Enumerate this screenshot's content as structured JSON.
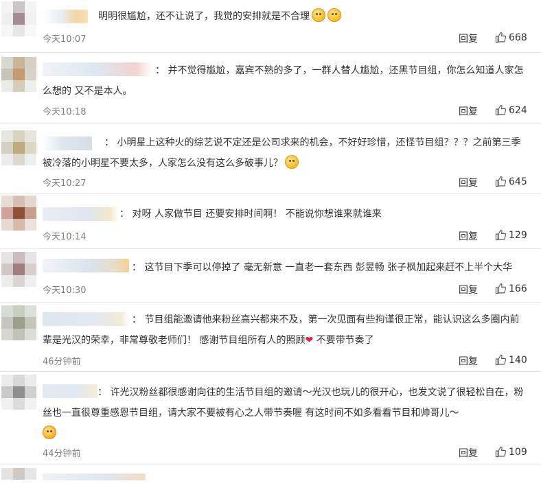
{
  "comments": [
    {
      "text": "明明很尴尬，还不让说了，我觉的安排就是不合理",
      "emojis": [
        "shush-face-emoji",
        "shush-face-emoji"
      ],
      "time": "今天10:07",
      "reply_label": "回复",
      "likes": "668"
    },
    {
      "text": "：  并不觉得尴尬，嘉宾不熟的多了，一群人替人尴尬，还黑节目组，你怎么知道人家怎么想的 又不是本人。",
      "time": "今天10:18",
      "reply_label": "回复",
      "likes": "624"
    },
    {
      "text": "：  小明星上这种火的综艺说不定还是公司求来的机会，不好好珍惜，还怪节目组？？？之前第三季被冷落的小明星不要太多，人家怎么没有这么多破事儿？",
      "emojis": [
        "smile-face-emoji"
      ],
      "time": "今天10:27",
      "reply_label": "回复",
      "likes": "645"
    },
    {
      "text": "：  对呀 人家做节目 还要安排时间啊！ 不能说你想谁来就谁来",
      "time": "今天10:14",
      "reply_label": "回复",
      "likes": "129"
    },
    {
      "text": "：  这节目下季可以停掉了 毫无新意 一直老一套东西 彭昱畅 张子枫加起来赶不上半个大华",
      "time": "今天10:30",
      "reply_label": "回复",
      "likes": "166"
    },
    {
      "text": "：  节目组能邀请他来粉丝高兴都来不及，第一次见面有些拘谨很正常，能认识这么多圈内前辈是光汉的荣幸，非常尊敬老师们！ 感谢节目组所有人的照顾",
      "text_tail": " 不要带节奏了",
      "time": "46分钟前",
      "reply_label": "回复",
      "likes": "140"
    },
    {
      "text": "：  许光汉粉丝都很感谢向往的生活节目组的邀请～光汉也玩儿的很开心，也发文说了很轻松自在，粉丝也一直很尊重感恩节目组，请大家不要被有心之人带节奏喔 有这时间不如多看看节目和帅哥儿～",
      "emojis": [
        "blush-face-emoji"
      ],
      "time": "44分钟前",
      "reply_label": "回复",
      "likes": "109"
    }
  ],
  "colors": {
    "text": "#333333",
    "time": "#808080",
    "divider": "#e8e8e8",
    "heart": "#e0213d"
  }
}
